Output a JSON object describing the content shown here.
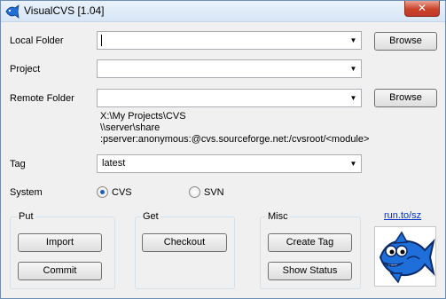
{
  "window": {
    "title": "VisualCVS [1.04]",
    "close_label": "✕",
    "icon": "fish-app-icon"
  },
  "form": {
    "local_folder": {
      "label": "Local Folder",
      "value": "",
      "browse_label": "Browse"
    },
    "project": {
      "label": "Project",
      "value": ""
    },
    "remote_folder": {
      "label": "Remote Folder",
      "value": "",
      "browse_label": "Browse",
      "hints": [
        "X:\\My Projects\\CVS",
        "\\\\server\\share",
        ":pserver:anonymous:@cvs.sourceforge.net:/cvsroot/<module>"
      ]
    },
    "tag": {
      "label": "Tag",
      "value": "latest"
    },
    "system": {
      "label": "System",
      "options": [
        {
          "label": "CVS",
          "checked": true
        },
        {
          "label": "SVN",
          "checked": false
        }
      ]
    }
  },
  "groups": {
    "put": {
      "title": "Put",
      "buttons": [
        "Import",
        "Commit"
      ]
    },
    "get": {
      "title": "Get",
      "buttons": [
        "Checkout"
      ]
    },
    "misc": {
      "title": "Misc",
      "buttons": [
        "Create Tag",
        "Show Status"
      ]
    }
  },
  "link": {
    "text": "run.to/sz"
  },
  "colors": {
    "link": "#0033cc",
    "fish": "#1e6fd9",
    "radio_dot": "#1e5fb5"
  }
}
